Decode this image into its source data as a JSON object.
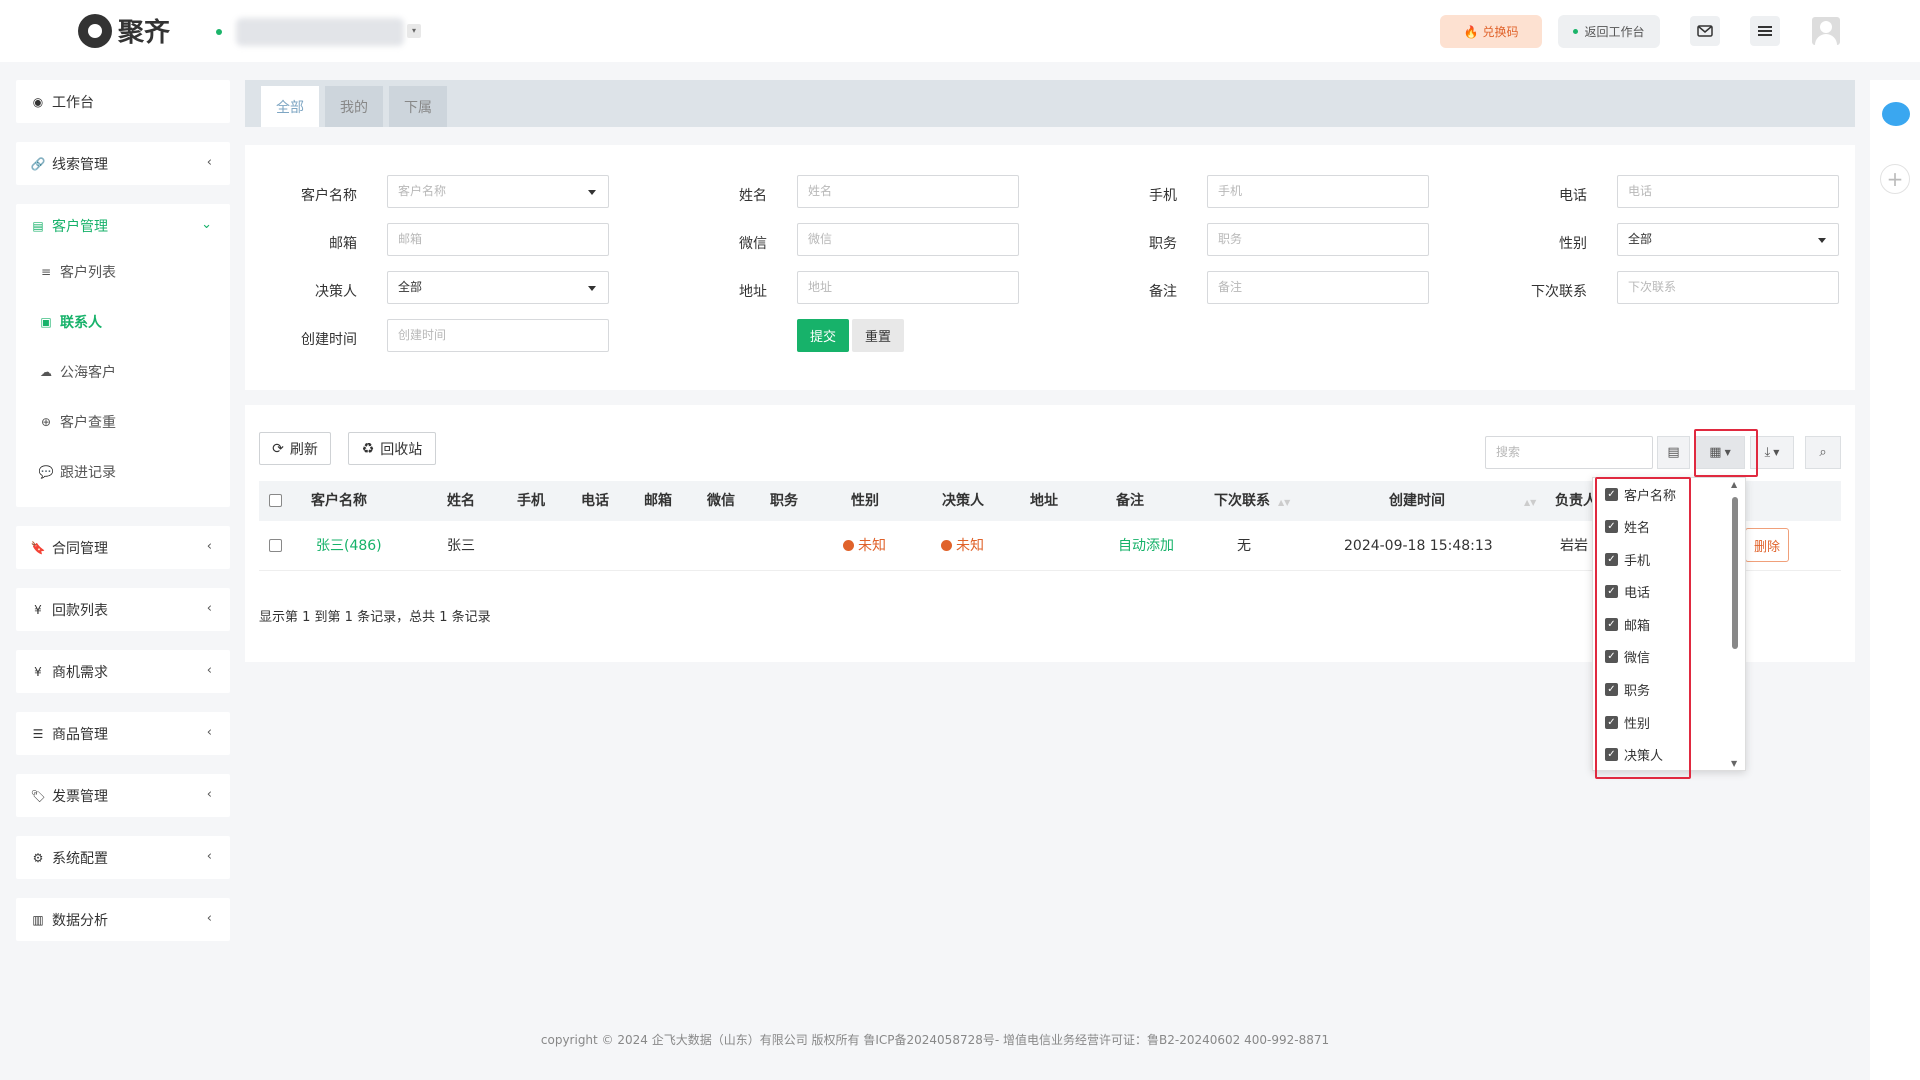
{
  "brand": {
    "name": "聚齐"
  },
  "header": {
    "exchange_label": "兑换码",
    "return_label": "返回工作台"
  },
  "sidebar": {
    "items": [
      {
        "label": "工作台",
        "icon": "dashboard-icon"
      },
      {
        "label": "线索管理",
        "icon": "link-icon"
      },
      {
        "label": "客户管理",
        "icon": "id-card-icon"
      },
      {
        "label": "合同管理",
        "icon": "bookmark-icon"
      },
      {
        "label": "回款列表",
        "icon": "yen-icon"
      },
      {
        "label": "商机需求",
        "icon": "yen-icon"
      },
      {
        "label": "商品管理",
        "icon": "list-icon"
      },
      {
        "label": "发票管理",
        "icon": "tag-icon"
      },
      {
        "label": "系统配置",
        "icon": "gears-icon"
      },
      {
        "label": "数据分析",
        "icon": "bar-chart-icon"
      }
    ],
    "customer_sub": [
      {
        "label": "客户列表",
        "icon": "list-icon"
      },
      {
        "label": "联系人",
        "icon": "contact-card-icon",
        "active": true
      },
      {
        "label": "公海客户",
        "icon": "cloud-icon"
      },
      {
        "label": "客户查重",
        "icon": "search-plus-icon"
      },
      {
        "label": "跟进记录",
        "icon": "comments-icon"
      }
    ]
  },
  "tabs": [
    "全部",
    "我的",
    "下属"
  ],
  "filter": {
    "customer_name": {
      "label": "客户名称",
      "placeholder": "客户名称"
    },
    "name": {
      "label": "姓名",
      "placeholder": "姓名"
    },
    "mobile": {
      "label": "手机",
      "placeholder": "手机"
    },
    "phone": {
      "label": "电话",
      "placeholder": "电话"
    },
    "email": {
      "label": "邮箱",
      "placeholder": "邮箱"
    },
    "wechat": {
      "label": "微信",
      "placeholder": "微信"
    },
    "position": {
      "label": "职务",
      "placeholder": "职务"
    },
    "gender": {
      "label": "性别",
      "value": "全部"
    },
    "decision_maker": {
      "label": "决策人",
      "value": "全部"
    },
    "address": {
      "label": "地址",
      "placeholder": "地址"
    },
    "remark": {
      "label": "备注",
      "placeholder": "备注"
    },
    "next_contact": {
      "label": "下次联系",
      "placeholder": "下次联系"
    },
    "created": {
      "label": "创建时间",
      "placeholder": "创建时间"
    },
    "submit_label": "提交",
    "reset_label": "重置"
  },
  "toolbar": {
    "refresh_label": "刷新",
    "recycle_label": "回收站",
    "search_placeholder": "搜索"
  },
  "table": {
    "headers": [
      "客户名称",
      "姓名",
      "手机",
      "电话",
      "邮箱",
      "微信",
      "职务",
      "性别",
      "决策人",
      "地址",
      "备注",
      "下次联系",
      "创建时间",
      "负责人"
    ],
    "rows": [
      {
        "customer_name": "张三(486)",
        "name": "张三",
        "mobile": "",
        "phone": "",
        "email": "",
        "wechat": "",
        "position": "",
        "gender": "未知",
        "decision_maker": "未知",
        "address": "",
        "remark": "自动添加",
        "next_contact": "无",
        "created": "2024-09-18 15:48:13",
        "owner": "岩岩",
        "delete_label": "删除"
      }
    ],
    "summary": "显示第 1 到第 1 条记录，总共 1 条记录"
  },
  "columns_menu": [
    "客户名称",
    "姓名",
    "手机",
    "电话",
    "邮箱",
    "微信",
    "职务",
    "性别",
    "决策人"
  ],
  "footer": "copyright © 2024 企飞大数据（山东）有限公司 版权所有 鲁ICP备2024058728号- 增值电信业务经营许可证：鲁B2-20240602 400-992-8871",
  "colors": {
    "accent": "#17b26a",
    "warning": "#e0622a",
    "highlight": "#e0293f"
  }
}
